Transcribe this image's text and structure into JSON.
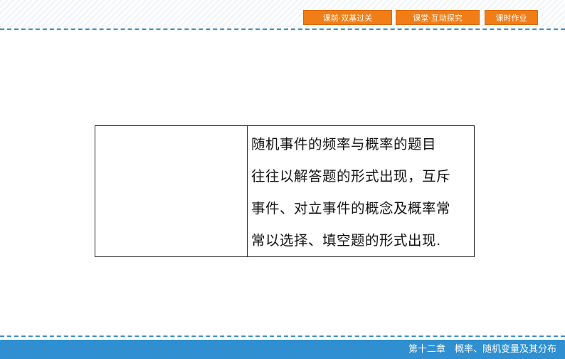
{
  "nav": {
    "items": [
      {
        "label": "课前·双基过关"
      },
      {
        "label": "课堂·互动探究"
      },
      {
        "label": "课时作业"
      }
    ]
  },
  "table": {
    "left_cell": "",
    "right_lines": [
      "随机事件的频率与概率的题目",
      "往往以解答题的形式出现，互斥",
      "事件、对立事件的概念及概率常",
      "常以选择、填空题的形式出现."
    ]
  },
  "footer": {
    "chapter": "第十二章　概率、随机变量及其分布"
  },
  "colors": {
    "nav_button": "#f07d16",
    "accent_blue": "#2f8fd0"
  }
}
